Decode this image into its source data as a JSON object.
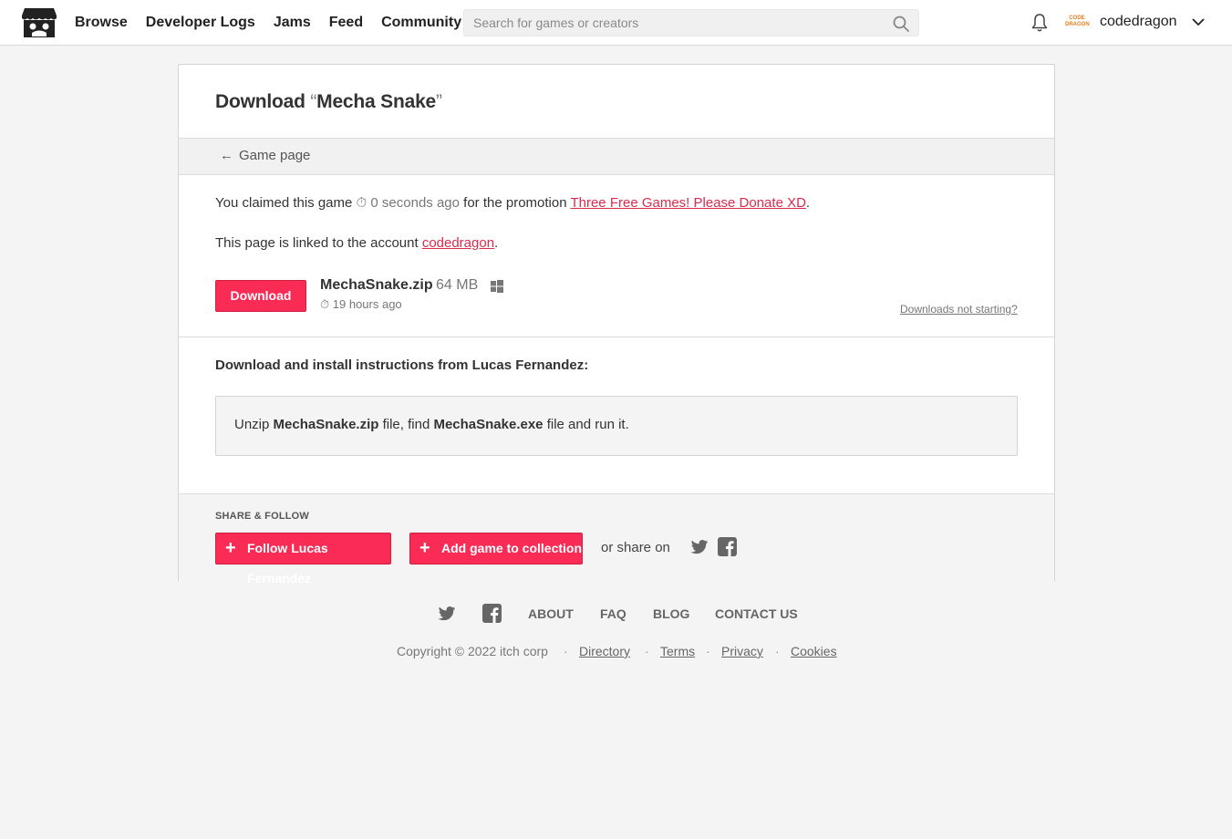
{
  "header": {
    "nav": [
      "Browse",
      "Developer Logs",
      "Jams",
      "Feed",
      "Community"
    ],
    "search_placeholder": "Search for games or creators",
    "avatar_text": "CODE DRAGON",
    "username": "codedragon"
  },
  "page": {
    "title_prefix": "Download ",
    "open_quote": "“",
    "game_name": "Mecha Snake",
    "close_quote": "”",
    "back_arrow": "←",
    "back_label": "Game page"
  },
  "claim": {
    "text_before": "You claimed this game ",
    "time_icon": "⏱",
    "time": "0 seconds ago",
    "text_mid": " for the promotion ",
    "promotion": "Three Free Games! Please Donate XD",
    "text_end": "."
  },
  "account": {
    "text_before": "This page is linked to the account ",
    "account_name": "codedragon",
    "text_end": "."
  },
  "download": {
    "button_label": "Download",
    "file_name": "MechaSnake.zip",
    "file_size": "64 MB",
    "time_icon": "⏱",
    "uploaded": "19 hours ago",
    "not_starting": "Downloads not starting?"
  },
  "instructions": {
    "title": "Download and install instructions from Lucas Fernandez:",
    "part1": "Unzip ",
    "bold1": "MechaSnake.zip",
    "part2": " file, find ",
    "bold2": "MechaSnake.exe",
    "part3": " file and run it."
  },
  "share": {
    "label": "SHARE & FOLLOW",
    "plus": "+",
    "follow_label": "Follow Lucas Fernandez",
    "collection_label": "Add game to collection",
    "share_on": "or share on"
  },
  "footer": {
    "links": [
      "ABOUT",
      "FAQ",
      "BLOG",
      "CONTACT US"
    ],
    "copyright": "Copyright © 2022 itch corp",
    "dot": "·",
    "legal": [
      "Directory",
      "Terms",
      "Privacy",
      "Cookies"
    ]
  },
  "colors": {
    "accent": "#fa2b55",
    "link": "#da2c4d",
    "background": "#f4f4f4"
  },
  "icons": [
    "itch-logo-icon",
    "search-icon",
    "bell-icon",
    "chevron-down-icon",
    "windows-icon",
    "stopwatch-icon",
    "twitter-icon",
    "facebook-icon",
    "plus-icon",
    "arrow-left-icon"
  ]
}
